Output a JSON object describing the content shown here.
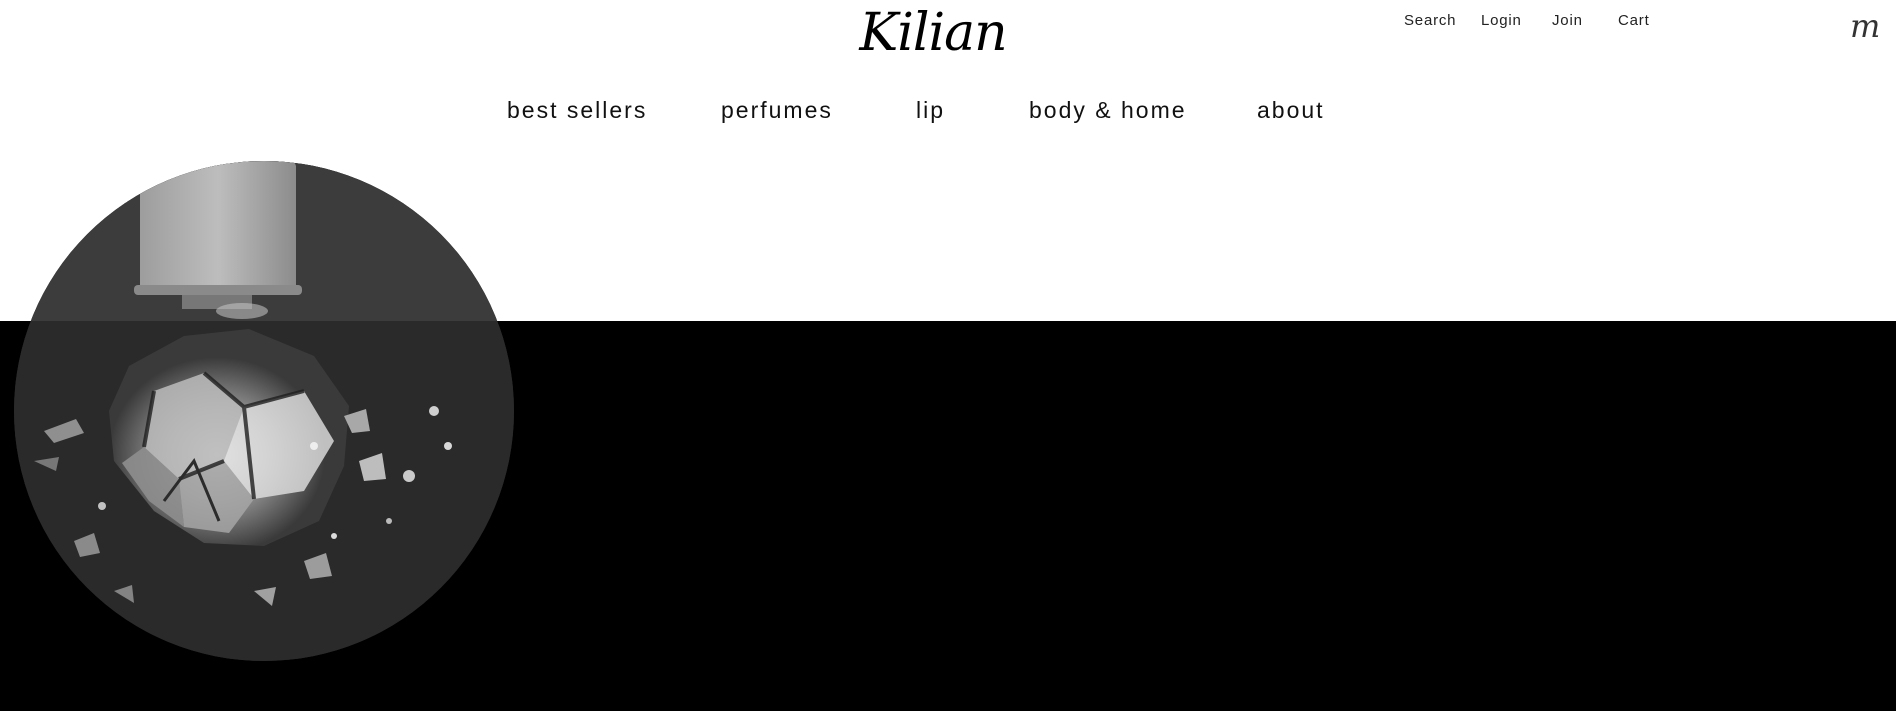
{
  "brand": {
    "logo_text": "Kilian"
  },
  "utility_nav": {
    "search_label": "Search",
    "login_label": "Login",
    "join_label": "Join",
    "cart_label": "Cart"
  },
  "menu_toggle": {
    "glyph": "m",
    "icon": "menu-monogram-icon"
  },
  "main_nav": {
    "items": [
      {
        "label": "best sellers"
      },
      {
        "label": "perfumes"
      },
      {
        "label": "lip"
      },
      {
        "label": "body & home"
      },
      {
        "label": "about"
      }
    ]
  },
  "hero": {
    "image_subject": "shattering perfume bottle",
    "colors": {
      "band": "#000000",
      "background": "#ffffff"
    }
  }
}
